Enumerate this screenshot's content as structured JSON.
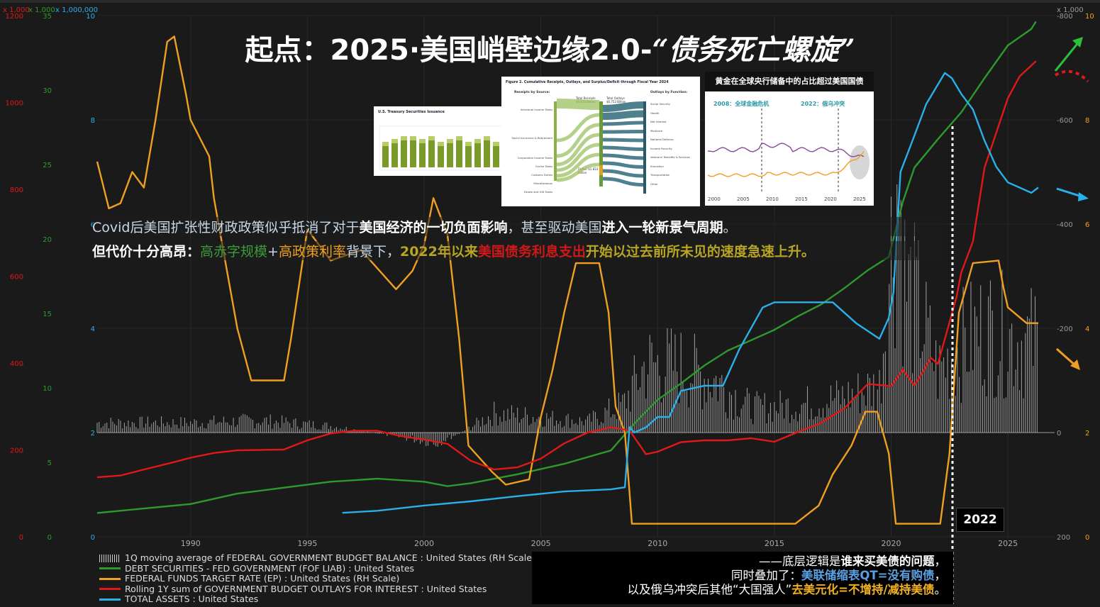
{
  "title": {
    "main": "起点：2025·美国峭壁边缘2.0-",
    "italic": "“债务死亡螺旋”"
  },
  "notes": {
    "line1_a": "Covid后美国扩张性财政政策似乎抵消了对于",
    "line1_b": "美国经济的一切负面影响",
    "line1_c": "，甚至驱动美国",
    "line1_d": "进入一轮新景气周期",
    "line1_e": "。",
    "line2_a": "但代价十分高昂：",
    "line2_b": "高赤字规模",
    "line2_c": "+",
    "line2_d": "高政策利率",
    "line2_e": "背景下，",
    "line2_f": "2022年以来",
    "line2_g": "美国债务利息支出",
    "line2_h": "开始以过去前所未见的速度急速上升。"
  },
  "conclusion": {
    "l1_a": "——底层逻辑是",
    "l1_b": "谁来买美债的问题",
    "l1_c": "，",
    "l2_a": "同时叠加了：",
    "l2_b": "美联储缩表QT=没有购债",
    "l2_c": "，",
    "l3_a": "以及俄乌冲突后其他“大国强人”",
    "l3_b": "去美元化=不增持/减持美债",
    "l3_c": "。"
  },
  "badge_2022": "2022",
  "insets": {
    "treasury_title": "U.S. Treasury Securities Issuance",
    "receipts_title": "Figure 2. Cumulative Receipts, Outlays, and Surplus/Deficit through Fiscal Year 2024",
    "receipts_left": "Receipts by Source:",
    "receipts_right": "Outlays by Function:",
    "receipts_total": "Total Receipts $4,919 Billion",
    "outlays_total": "Total Outlays $6,752 Billion",
    "deficit": "Deficit $1,833 Billion",
    "receipt_items": [
      "Individual Income Taxes",
      "Social Insurance & Retirement",
      "Corporation Income Taxes",
      "Excise Taxes",
      "Customs Duties",
      "Miscellaneous",
      "Estate and Gift Taxes"
    ],
    "outlay_items": [
      "Social Security",
      "Health",
      "Net Interest",
      "Medicare",
      "National Defense",
      "Income Security",
      "Veterans' Benefits & Services",
      "Education",
      "Transportation",
      "Other"
    ],
    "gold_title": "黄金在全球央行储备中的占比超过美国国债",
    "gold_lbl1": "2008：全球金融危机",
    "gold_lbl2": "2022：俄乌冲突",
    "gold_years": [
      "2000",
      "2005",
      "2010",
      "2015",
      "2020",
      "2025"
    ]
  },
  "legend": [
    {
      "label": "1Q moving average of FEDERAL GOVERNMENT BUDGET BALANCE : United States (RH Scale)",
      "color": "#cfcfcf",
      "kind": "bars"
    },
    {
      "label": "DEBT SECURITIES - FED GOVERNMENT (FOF LIAB) : United States",
      "color": "#2e9a2e",
      "kind": "line"
    },
    {
      "label": "FEDERAL FUNDS TARGET RATE (EP) : United States (RH Scale)",
      "color": "#f0a020",
      "kind": "line"
    },
    {
      "label": "Rolling 1Y sum of GOVERNMENT BUDGET OUTLAYS FOR INTEREST : United States",
      "color": "#e01818",
      "kind": "line"
    },
    {
      "label": "TOTAL ASSETS : United States",
      "color": "#2ab0e8",
      "kind": "line"
    }
  ],
  "axes": {
    "red_header": "x 1,000",
    "green_header": "x 1,000",
    "blue_header": "x 1,000,000",
    "right_header": "x 1,000",
    "red_ticks": [
      "1200",
      "1000",
      "800",
      "600",
      "400",
      "200",
      "0"
    ],
    "green_ticks": [
      "35",
      "30",
      "25",
      "20",
      "15",
      "10",
      "5",
      "0"
    ],
    "blue_ticks": [
      "10",
      "8",
      "6",
      "4",
      "2",
      "0"
    ],
    "bal_ticks": [
      "-800",
      "-600",
      "-400",
      "-200",
      "0",
      "200"
    ],
    "rate_ticks": [
      "10",
      "8",
      "6",
      "4",
      "2",
      "0"
    ],
    "x_ticks": [
      "1990",
      "1995",
      "2000",
      "2005",
      "2010",
      "2015",
      "2020",
      "2025"
    ]
  },
  "colors": {
    "green": "#2e9a2e",
    "orange": "#f0a020",
    "red": "#e01818",
    "blue": "#2ab0e8",
    "bars": "#cfcfcf"
  },
  "chart_data": {
    "type": "line",
    "x_range": [
      1986,
      2027
    ],
    "series": [
      {
        "name": "DEBT SECURITIES - FED GOVERNMENT (FOF LIAB) : United States",
        "unit": "x 1,000",
        "axis": "green",
        "ylim": [
          0,
          35
        ],
        "points": [
          [
            1986,
            1.6
          ],
          [
            1988,
            1.9
          ],
          [
            1990,
            2.2
          ],
          [
            1992,
            2.9
          ],
          [
            1994,
            3.3
          ],
          [
            1996,
            3.7
          ],
          [
            1998,
            3.9
          ],
          [
            2000,
            3.7
          ],
          [
            2001,
            3.4
          ],
          [
            2002,
            3.6
          ],
          [
            2004,
            4.2
          ],
          [
            2006,
            4.9
          ],
          [
            2008,
            5.8
          ],
          [
            2009,
            7.6
          ],
          [
            2010,
            9.2
          ],
          [
            2011,
            10.3
          ],
          [
            2012,
            11.5
          ],
          [
            2013,
            12.5
          ],
          [
            2014,
            13.2
          ],
          [
            2015,
            13.9
          ],
          [
            2016,
            14.8
          ],
          [
            2017,
            15.6
          ],
          [
            2018,
            16.7
          ],
          [
            2019,
            17.9
          ],
          [
            2019.9,
            18.8
          ],
          [
            2020.5,
            22.5
          ],
          [
            2021,
            24.8
          ],
          [
            2022,
            26.7
          ],
          [
            2023,
            28.5
          ],
          [
            2024,
            30.8
          ],
          [
            2025,
            33.0
          ],
          [
            2026,
            34.1
          ],
          [
            2026.2,
            34.6
          ]
        ]
      },
      {
        "name": "FEDERAL FUNDS TARGET RATE (EP) : United States (RH Scale)",
        "unit": "%",
        "axis": "rate",
        "ylim": [
          0,
          10
        ],
        "points": [
          [
            1986,
            7.2
          ],
          [
            1986.5,
            6.3
          ],
          [
            1987,
            6.4
          ],
          [
            1987.5,
            7.0
          ],
          [
            1988,
            6.7
          ],
          [
            1988.5,
            8.0
          ],
          [
            1989,
            9.5
          ],
          [
            1989.3,
            9.6
          ],
          [
            1989.8,
            8.5
          ],
          [
            1990,
            8.0
          ],
          [
            1990.8,
            7.3
          ],
          [
            1991,
            6.5
          ],
          [
            1991.8,
            4.5
          ],
          [
            1992,
            4.0
          ],
          [
            1992.6,
            3.0
          ],
          [
            1994,
            3.0
          ],
          [
            1994.3,
            3.8
          ],
          [
            1994.8,
            5.3
          ],
          [
            1995,
            5.9
          ],
          [
            1995.5,
            5.6
          ],
          [
            1996,
            5.3
          ],
          [
            1997.3,
            5.5
          ],
          [
            1998.8,
            4.75
          ],
          [
            1999.5,
            5.1
          ],
          [
            2000,
            5.6
          ],
          [
            2000.4,
            6.5
          ],
          [
            2001,
            5.8
          ],
          [
            2001.5,
            3.8
          ],
          [
            2001.9,
            1.75
          ],
          [
            2002.9,
            1.25
          ],
          [
            2003.5,
            1.0
          ],
          [
            2004.5,
            1.1
          ],
          [
            2005,
            2.3
          ],
          [
            2005.5,
            3.2
          ],
          [
            2006,
            4.3
          ],
          [
            2006.5,
            5.25
          ],
          [
            2007.5,
            5.25
          ],
          [
            2007.9,
            4.3
          ],
          [
            2008.2,
            2.5
          ],
          [
            2008.6,
            2.0
          ],
          [
            2008.9,
            0.25
          ],
          [
            2015.9,
            0.25
          ],
          [
            2016.9,
            0.6
          ],
          [
            2017.5,
            1.2
          ],
          [
            2018.3,
            1.75
          ],
          [
            2018.9,
            2.4
          ],
          [
            2019.4,
            2.4
          ],
          [
            2019.9,
            1.6
          ],
          [
            2020.2,
            0.25
          ],
          [
            2022.1,
            0.25
          ],
          [
            2022.5,
            1.6
          ],
          [
            2022.9,
            4.3
          ],
          [
            2023.5,
            5.25
          ],
          [
            2024.6,
            5.3
          ],
          [
            2024.8,
            4.8
          ],
          [
            2025,
            4.4
          ],
          [
            2025.8,
            4.1
          ],
          [
            2026.3,
            4.1
          ]
        ]
      },
      {
        "name": "Rolling 1Y sum of GOVERNMENT BUDGET OUTLAYS FOR INTEREST : United States",
        "unit": "x 1,000",
        "axis": "red",
        "ylim": [
          0,
          1200
        ],
        "points": [
          [
            1986,
            137
          ],
          [
            1987,
            141
          ],
          [
            1988,
            155
          ],
          [
            1989,
            168
          ],
          [
            1990,
            182
          ],
          [
            1991,
            193
          ],
          [
            1992,
            199
          ],
          [
            1993,
            200
          ],
          [
            1994,
            201
          ],
          [
            1995,
            222
          ],
          [
            1996,
            238
          ],
          [
            1997,
            244
          ],
          [
            1998,
            244
          ],
          [
            1999,
            232
          ],
          [
            2000,
            224
          ],
          [
            2001,
            214
          ],
          [
            2002,
            175
          ],
          [
            2003,
            155
          ],
          [
            2004,
            160
          ],
          [
            2005,
            180
          ],
          [
            2006,
            215
          ],
          [
            2007,
            240
          ],
          [
            2008,
            252
          ],
          [
            2008.8,
            245
          ],
          [
            2009.5,
            190
          ],
          [
            2010,
            196
          ],
          [
            2011,
            218
          ],
          [
            2012,
            222
          ],
          [
            2013,
            222
          ],
          [
            2014,
            227
          ],
          [
            2015,
            219
          ],
          [
            2016,
            241
          ],
          [
            2017,
            262
          ],
          [
            2018,
            296
          ],
          [
            2019,
            352
          ],
          [
            2020,
            347
          ],
          [
            2020.5,
            385
          ],
          [
            2021,
            348
          ],
          [
            2021.7,
            412
          ],
          [
            2022,
            398
          ],
          [
            2022.8,
            552
          ],
          [
            2023,
            608
          ],
          [
            2023.5,
            680
          ],
          [
            2024,
            850
          ],
          [
            2024.5,
            930
          ],
          [
            2025,
            1010
          ],
          [
            2025.5,
            1060
          ],
          [
            2026.2,
            1095
          ]
        ]
      },
      {
        "name": "TOTAL ASSETS : United States",
        "unit": "x 1,000,000",
        "axis": "blue",
        "ylim": [
          0,
          10
        ],
        "points": [
          [
            1996.5,
            0.46
          ],
          [
            1998,
            0.5
          ],
          [
            2000,
            0.6
          ],
          [
            2002,
            0.68
          ],
          [
            2004,
            0.78
          ],
          [
            2006,
            0.87
          ],
          [
            2008,
            0.91
          ],
          [
            2008.6,
            0.95
          ],
          [
            2008.8,
            2.1
          ],
          [
            2009,
            2.0
          ],
          [
            2009.5,
            2.1
          ],
          [
            2010,
            2.3
          ],
          [
            2010.5,
            2.3
          ],
          [
            2011,
            2.8
          ],
          [
            2012,
            2.9
          ],
          [
            2012.8,
            2.9
          ],
          [
            2013.5,
            3.6
          ],
          [
            2014.5,
            4.4
          ],
          [
            2015,
            4.5
          ],
          [
            2016,
            4.5
          ],
          [
            2017.5,
            4.5
          ],
          [
            2018.5,
            4.1
          ],
          [
            2019.5,
            3.8
          ],
          [
            2019.9,
            4.2
          ],
          [
            2020.1,
            4.7
          ],
          [
            2020.4,
            7.0
          ],
          [
            2021,
            7.7
          ],
          [
            2021.5,
            8.3
          ],
          [
            2022.3,
            8.9
          ],
          [
            2022.6,
            8.8
          ],
          [
            2023,
            8.5
          ],
          [
            2023.5,
            8.2
          ],
          [
            2024,
            7.6
          ],
          [
            2024.5,
            7.1
          ],
          [
            2025,
            6.8
          ],
          [
            2025.5,
            6.7
          ],
          [
            2026,
            6.6
          ],
          [
            2026.3,
            6.7
          ]
        ]
      },
      {
        "name": "1Q moving average of FEDERAL GOVERNMENT BUDGET BALANCE : United States (RH Scale)",
        "unit": "x 1,000",
        "axis": "balance",
        "ylim": [
          -800,
          200
        ],
        "note": "bars: roughly -15 to -20 (1986-1997), near 0 to +20 (1998-2001), -40 to -100 (2002-2007), -100 to -150 (2009-2012), -30 to -90 (2013-2019), to -600 (2020), -150 to -250 (2021-2026)",
        "approx": [
          [
            1986,
            -18
          ],
          [
            1990,
            -18
          ],
          [
            1993,
            -22
          ],
          [
            1996,
            -12
          ],
          [
            1999,
            8
          ],
          [
            2000.5,
            18
          ],
          [
            2001.5,
            2
          ],
          [
            2003,
            -35
          ],
          [
            2005,
            -28
          ],
          [
            2007,
            -20
          ],
          [
            2008.5,
            -50
          ],
          [
            2009.5,
            -125
          ],
          [
            2011,
            -120
          ],
          [
            2012.5,
            -95
          ],
          [
            2014,
            -45
          ],
          [
            2016,
            -50
          ],
          [
            2018,
            -65
          ],
          [
            2019.5,
            -85
          ],
          [
            2020.3,
            -480
          ],
          [
            2020.6,
            -270
          ],
          [
            2021.2,
            -220
          ],
          [
            2022,
            -110
          ],
          [
            2023,
            -160
          ],
          [
            2024,
            -190
          ],
          [
            2025,
            -175
          ],
          [
            2026,
            -165
          ]
        ]
      }
    ]
  }
}
